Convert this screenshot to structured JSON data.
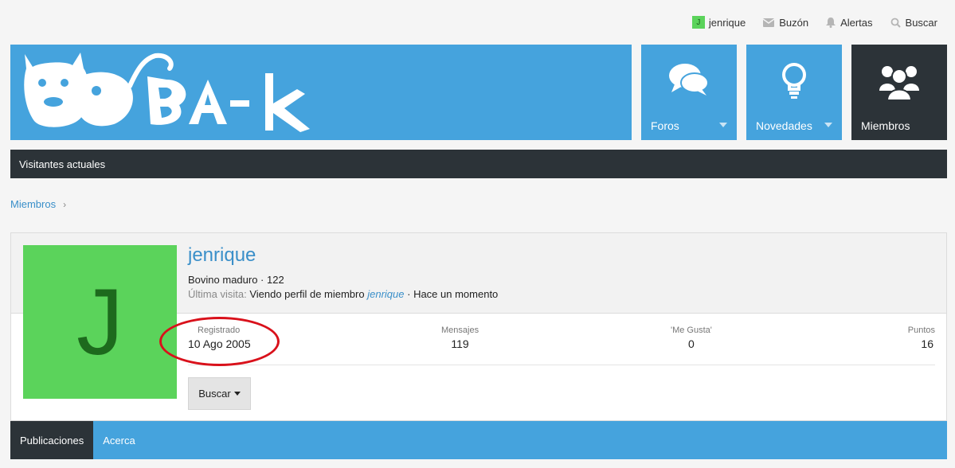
{
  "userbar": {
    "avatar_letter": "J",
    "username": "jenrique",
    "inbox": "Buzón",
    "alerts": "Alertas",
    "search": "Buscar"
  },
  "header": {
    "logo_text": "BA-k",
    "nav": [
      {
        "label": "Foros",
        "icon": "speech-bubbles-icon",
        "has_menu": true,
        "active": false
      },
      {
        "label": "Novedades",
        "icon": "lightbulb-icon",
        "has_menu": true,
        "active": false
      },
      {
        "label": "Miembros",
        "icon": "users-icon",
        "has_menu": false,
        "active": true
      }
    ]
  },
  "subnav": {
    "current_visitors": "Visitantes actuales"
  },
  "breadcrumb": {
    "members": "Miembros"
  },
  "profile": {
    "avatar_letter": "J",
    "username": "jenrique",
    "title_line": "Bovino maduro · 122",
    "last_seen_label": "Última visita:",
    "last_seen_text": "Viendo perfil de miembro",
    "last_seen_member": "jenrique",
    "last_seen_time": "· Hace un momento",
    "stats": [
      {
        "label": "Registrado",
        "value": "10 Ago 2005"
      },
      {
        "label": "Mensajes",
        "value": "119"
      },
      {
        "label": "'Me Gusta'",
        "value": "0"
      },
      {
        "label": "Puntos",
        "value": "16"
      }
    ],
    "search_button": "Buscar"
  },
  "tabs": [
    {
      "label": "Publicaciones",
      "active": true
    },
    {
      "label": "Acerca",
      "active": false
    }
  ],
  "colors": {
    "accent_blue": "#45a3dd",
    "dark": "#2c3338",
    "avatar_green": "#5bd35b",
    "annotation_red": "#d9111b"
  }
}
